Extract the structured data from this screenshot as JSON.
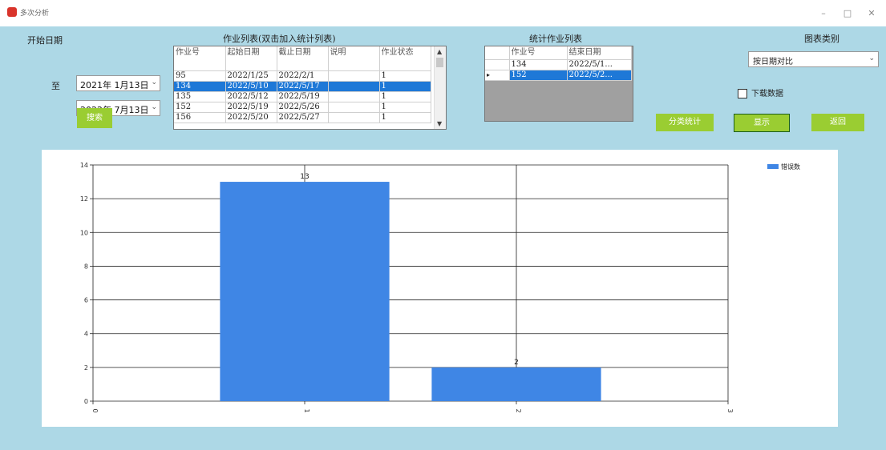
{
  "window": {
    "title": "多次分析",
    "minimize": "–",
    "maximize": "□",
    "close": "✕"
  },
  "filters": {
    "start_label": "开始日期",
    "to_label": "至",
    "start_date": "2021年 1月13日",
    "end_date": "2022年 7月13日",
    "search_label": "搜索"
  },
  "job_list": {
    "title": "作业列表(双击加入统计列表)",
    "columns": [
      "作业号",
      "起始日期",
      "截止日期",
      "说明",
      "作业状态"
    ],
    "rows": [
      [
        "95",
        "2022/1/25",
        "2022/2/1",
        "",
        "1"
      ],
      [
        "134",
        "2022/5/10",
        "2022/5/17",
        "",
        "1"
      ],
      [
        "135",
        "2022/5/12",
        "2022/5/19",
        "",
        "1"
      ],
      [
        "152",
        "2022/5/19",
        "2022/5/26",
        "",
        "1"
      ],
      [
        "156",
        "2022/5/20",
        "2022/5/27",
        "",
        "1"
      ]
    ],
    "selected_row": 1
  },
  "stat_list": {
    "title": "统计作业列表",
    "columns": [
      "作业号",
      "结束日期"
    ],
    "rows": [
      [
        "134",
        "2022/5/1..."
      ],
      [
        "152",
        "2022/5/2..."
      ]
    ],
    "selected_row": 1,
    "row_marker": "▸"
  },
  "chart_type": {
    "title": "图表类别",
    "selected": "按日期对比",
    "download_label": "下载数据"
  },
  "buttons": {
    "category_stats": "分类统计",
    "display": "显示",
    "back": "返回"
  },
  "chart_data": {
    "type": "bar",
    "x": [
      1,
      2
    ],
    "values": [
      13,
      2
    ],
    "xlim": [
      0,
      3
    ],
    "ylim": [
      0,
      14
    ],
    "yticks": [
      0,
      2,
      4,
      6,
      8,
      10,
      12,
      14
    ],
    "xticks": [
      0,
      1,
      2,
      3
    ],
    "data_labels": [
      "13",
      "2"
    ],
    "series": [
      {
        "name": "错误数",
        "values": [
          13,
          2
        ]
      }
    ],
    "color": "#3f86e5",
    "grid": true,
    "legend": "top-right"
  }
}
